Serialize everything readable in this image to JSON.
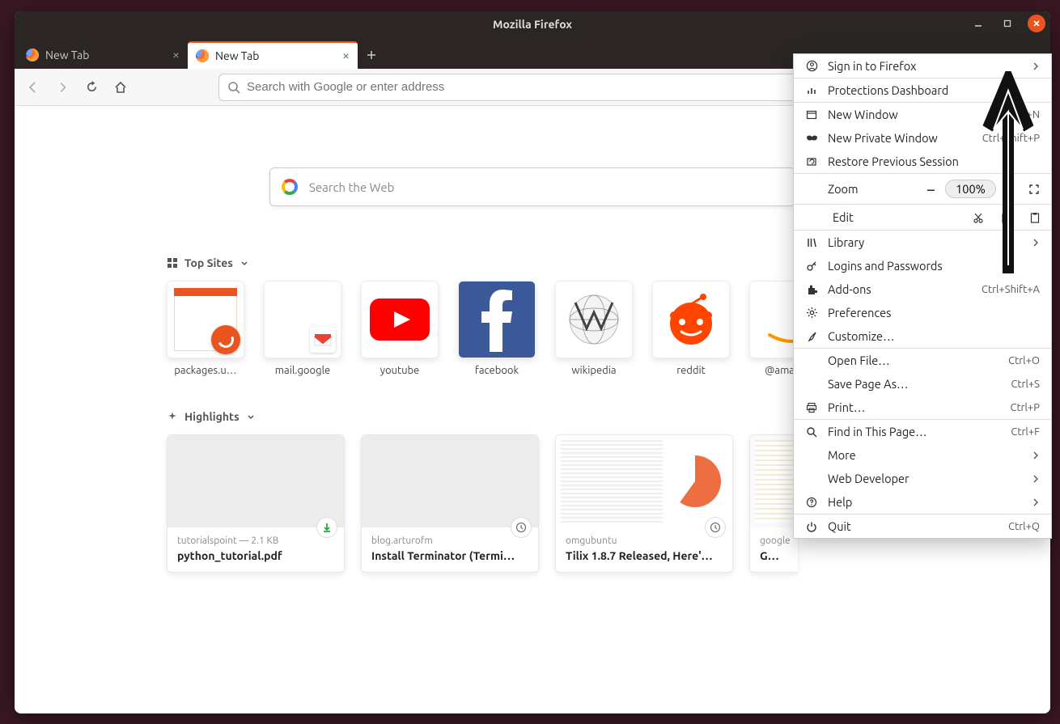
{
  "window": {
    "title": "Mozilla Firefox"
  },
  "tabs": [
    {
      "label": "New Tab",
      "active": false
    },
    {
      "label": "New Tab",
      "active": true
    }
  ],
  "urlbar": {
    "placeholder": "Search with Google or enter address"
  },
  "heroSearch": {
    "placeholder": "Search the Web"
  },
  "sections": {
    "topSites": "Top Sites",
    "highlights": "Highlights"
  },
  "topSites": [
    {
      "label": "packages.u…"
    },
    {
      "label": "mail.google"
    },
    {
      "label": "youtube"
    },
    {
      "label": "facebook"
    },
    {
      "label": "wikipedia"
    },
    {
      "label": "reddit"
    },
    {
      "label": "@amazon"
    }
  ],
  "highlights": [
    {
      "source": "tutorialspoint — 2.1 KB",
      "title": "python_tutorial.pdf",
      "badge": "download"
    },
    {
      "source": "blog.arturofm",
      "title": "Install Terminator (Termi…",
      "badge": "clock"
    },
    {
      "source": "omgubuntu",
      "title": "Tilix 1.8.7 Released, Here'…",
      "badge": "clock"
    },
    {
      "source": "google",
      "title": "Gmail",
      "badge": ""
    }
  ],
  "menu": {
    "signin": "Sign in to Firefox",
    "protections": "Protections Dashboard",
    "newWindow": {
      "label": "New Window",
      "shortcut": "Ctrl+N"
    },
    "newPrivate": {
      "label": "New Private Window",
      "shortcut": "Ctrl+Shift+P"
    },
    "restore": "Restore Previous Session",
    "zoom": {
      "label": "Zoom",
      "value": "100%"
    },
    "edit": "Edit",
    "library": "Library",
    "logins": "Logins and Passwords",
    "addons": {
      "label": "Add-ons",
      "shortcut": "Ctrl+Shift+A"
    },
    "prefs": "Preferences",
    "customize": "Customize…",
    "openFile": {
      "label": "Open File…",
      "shortcut": "Ctrl+O"
    },
    "saveAs": {
      "label": "Save Page As…",
      "shortcut": "Ctrl+S"
    },
    "print": {
      "label": "Print…",
      "shortcut": "Ctrl+P"
    },
    "find": {
      "label": "Find in This Page…",
      "shortcut": "Ctrl+F"
    },
    "more": "More",
    "webdev": "Web Developer",
    "help": "Help",
    "quit": {
      "label": "Quit",
      "shortcut": "Ctrl+Q"
    }
  }
}
